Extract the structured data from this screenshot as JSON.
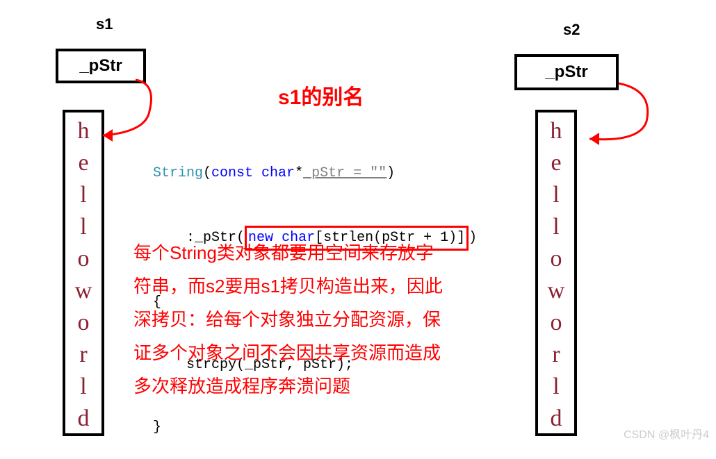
{
  "labels": {
    "s1": "s1",
    "s2": "s2",
    "pStr_left": "_pStr",
    "pStr_right": "_pStr"
  },
  "title": "s1的别名",
  "vert_chars": [
    "h",
    "e",
    "l",
    "l",
    "o",
    "w",
    "o",
    "r",
    "l",
    "d"
  ],
  "code": {
    "line1_type": "String",
    "line1_paren_open": "(",
    "line1_kw": "const char",
    "line1_star": "*",
    "line1_param": " pStr = \"\"",
    "line1_close": ")",
    "line2_indent": "    :",
    "line2_id": "_pStr",
    "line2_open": "(",
    "line2_hl_new": "new ",
    "line2_hl_char": "char",
    "line2_hl_rest": "[strlen(pStr + 1)]",
    "line2_close": ")",
    "line3": "{",
    "line4_indent": "    ",
    "line4_call": "strcpy(_pStr, pStr);",
    "line5": "}"
  },
  "explain": "每个String类对象都要用空间来存放字\n符串，而s2要用s1拷贝构造出来，因此\n深拷贝：给每个对象独立分配资源，保\n证多个对象之间不会因共享资源而造成\n多次释放造成程序奔溃问题",
  "watermark": "CSDN @枫叶丹4",
  "colors": {
    "red": "#FF0000",
    "darkred_text": "#8B2030",
    "blue": "#0000ff"
  }
}
